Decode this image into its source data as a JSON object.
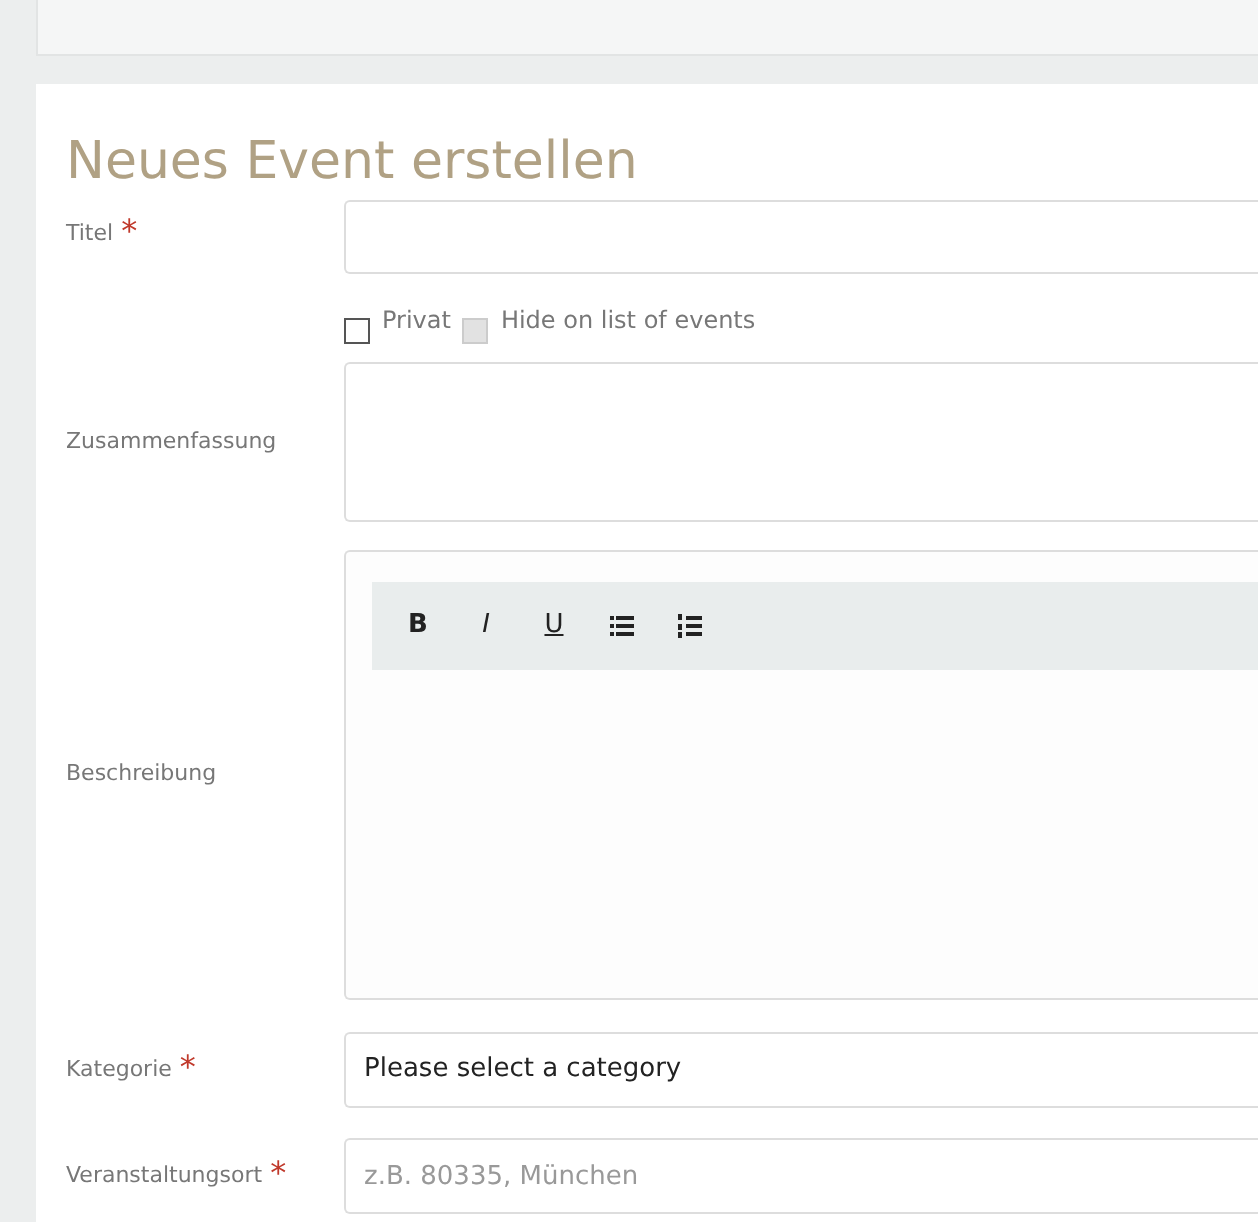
{
  "heading": "Neues Event erstellen",
  "title_field": {
    "label": "Titel",
    "mark": "*"
  },
  "checkboxes": [
    {
      "label": "Privat",
      "checked": false,
      "disabled": false
    },
    {
      "label": "Hide on list of events",
      "checked": false,
      "disabled": true
    }
  ],
  "summary_field": {
    "label": "Zusammenfassung"
  },
  "description_field": {
    "label": "Beschreibung",
    "toolbar": [
      {
        "kind": "bold",
        "label": "B"
      },
      {
        "kind": "italic",
        "label": "I"
      },
      {
        "kind": "underline",
        "label": "U"
      },
      {
        "kind": "bullet-list"
      },
      {
        "kind": "numbered-list"
      }
    ]
  },
  "category_field": {
    "label": "Kategorie",
    "mark": "*",
    "value": "Please select a category"
  },
  "location_field": {
    "label": "Veranstaltungsort",
    "mark": "*",
    "placeholder": "z.B. 80335, München"
  }
}
